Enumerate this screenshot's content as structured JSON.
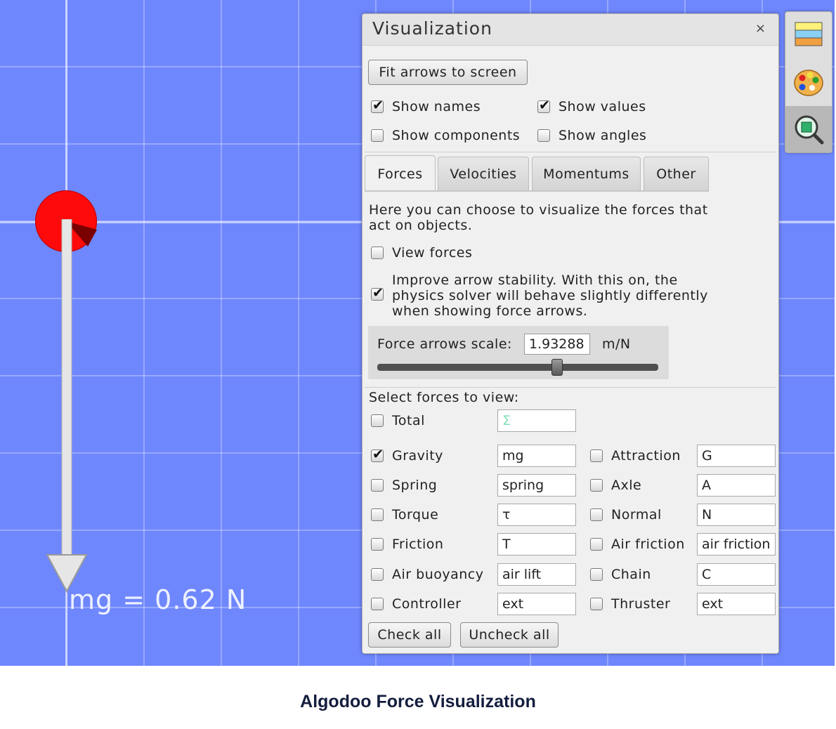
{
  "scene": {
    "force_label": "mg = 0.62 N"
  },
  "panel": {
    "title": "Visualization",
    "close_glyph": "×",
    "fit_button": "Fit arrows to screen",
    "show_names": {
      "label": "Show names",
      "checked": true
    },
    "show_values": {
      "label": "Show values",
      "checked": true
    },
    "show_components": {
      "label": "Show components",
      "checked": false
    },
    "show_angles": {
      "label": "Show angles",
      "checked": false
    },
    "tabs": [
      {
        "label": "Forces",
        "active": true
      },
      {
        "label": "Velocities",
        "active": false
      },
      {
        "label": "Momentums",
        "active": false
      },
      {
        "label": "Other",
        "active": false
      }
    ],
    "description_line1": "Here you can choose to visualize the forces that",
    "description_line2": "act on objects.",
    "view_forces": {
      "label": "View forces",
      "checked": false
    },
    "improve_stability": {
      "line1": "Improve arrow stability. With this on, the",
      "line2": "physics solver will behave slightly differently",
      "line3": "when showing force arrows.",
      "checked": true
    },
    "scale": {
      "label": "Force arrows scale:",
      "value": "1.93288",
      "unit": "m/N",
      "slider_fraction": 0.64
    },
    "select_label": "Select forces to view:",
    "total": {
      "label": "Total",
      "value": "Σ",
      "checked": false
    },
    "forces_left": [
      {
        "label": "Gravity",
        "value": "mg",
        "checked": true
      },
      {
        "label": "Spring",
        "value": "spring",
        "checked": false
      },
      {
        "label": "Torque",
        "value": "τ",
        "checked": false
      },
      {
        "label": "Friction",
        "value": "T",
        "checked": false
      },
      {
        "label": "Air buoyancy",
        "value": "air lift",
        "checked": false
      },
      {
        "label": "Controller",
        "value": "ext",
        "checked": false
      }
    ],
    "forces_right": [
      {
        "label": "Attraction",
        "value": "G",
        "checked": false
      },
      {
        "label": "Axle",
        "value": "A",
        "checked": false
      },
      {
        "label": "Normal",
        "value": "N",
        "checked": false
      },
      {
        "label": "Air friction",
        "value": "air friction",
        "checked": false
      },
      {
        "label": "Chain",
        "value": "C",
        "checked": false
      },
      {
        "label": "Thruster",
        "value": "ext",
        "checked": false
      }
    ],
    "check_all": "Check all",
    "uncheck_all": "Uncheck all"
  },
  "toolbar": {
    "tools": [
      {
        "icon": "layers-icon"
      },
      {
        "icon": "palette-icon"
      },
      {
        "icon": "visualization-magnifier-icon",
        "active": true
      }
    ]
  },
  "caption": "Algodoo Force Visualization",
  "colors": {
    "canvas": "#6f87fd",
    "ball": "#ff0a0a",
    "caption": "#141e3e"
  }
}
